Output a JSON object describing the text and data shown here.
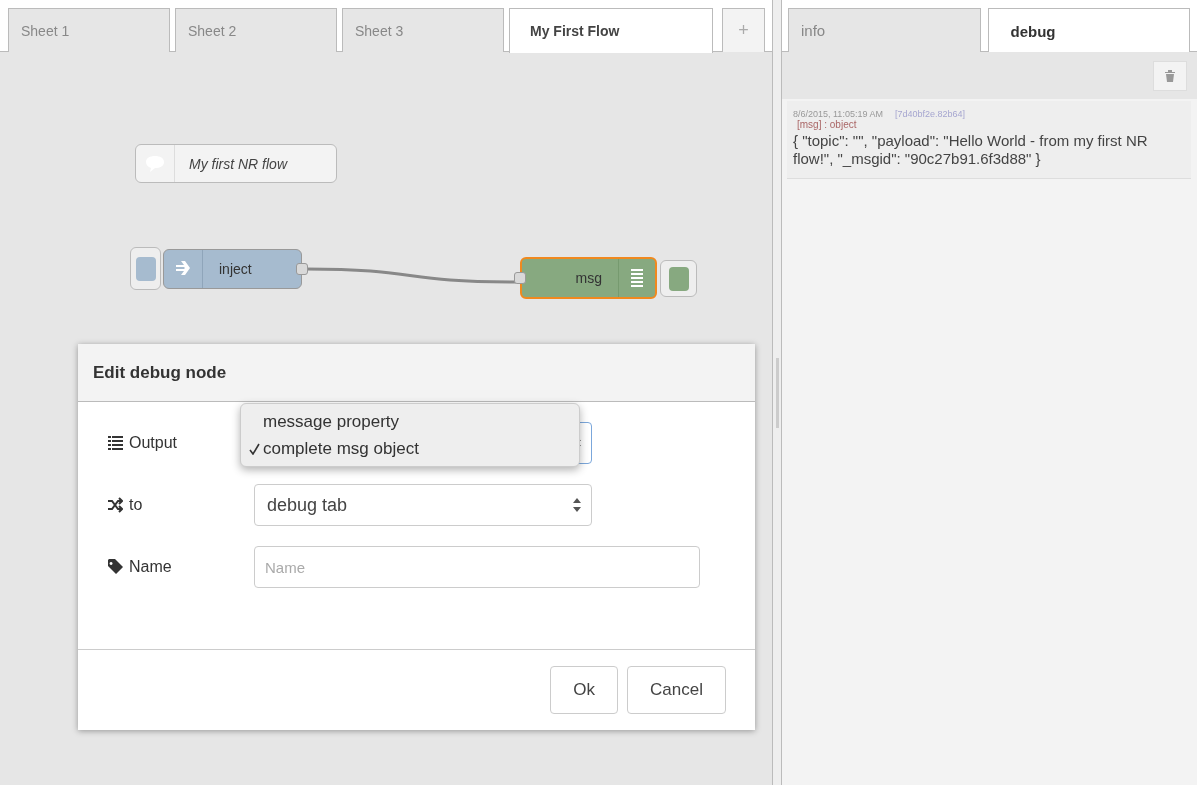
{
  "workspace_tabs": [
    {
      "label": "Sheet 1",
      "selected": false
    },
    {
      "label": "Sheet 2",
      "selected": false
    },
    {
      "label": "Sheet 3",
      "selected": false
    },
    {
      "label": "My First Flow",
      "selected": true
    }
  ],
  "add_tab": "+",
  "flow_nodes": [
    {
      "kind": "comment",
      "label": "My first NR flow",
      "selected": false
    },
    {
      "kind": "inject",
      "label": "inject",
      "selected": false
    },
    {
      "kind": "debug",
      "label": "msg",
      "selected": true
    }
  ],
  "dialog": {
    "title": "Edit debug node",
    "fields": [
      {
        "kind": "select",
        "label": "Output",
        "open": true,
        "options": [
          {
            "label": "message property",
            "selected": false
          },
          {
            "label": "complete msg object",
            "selected": true
          }
        ]
      },
      {
        "kind": "select",
        "label": "to",
        "value": "debug tab",
        "open": false
      },
      {
        "kind": "text",
        "label": "Name",
        "placeholder": "Name"
      }
    ],
    "buttons": [
      "Ok",
      "Cancel"
    ]
  },
  "sidebar": {
    "tabs": [
      {
        "label": "info",
        "selected": false
      },
      {
        "label": "debug",
        "selected": true
      }
    ],
    "messages": [
      {
        "time": "8/6/2015, 11:05:19 AM",
        "node_id": "[7d40bf2e.82b64]",
        "type": "[msg] : object",
        "body": "{ \"topic\": \"\", \"payload\": \"Hello World - from my first NR flow!\", \"_msgid\": \"90c27b91.6f3d88\" }"
      }
    ]
  }
}
